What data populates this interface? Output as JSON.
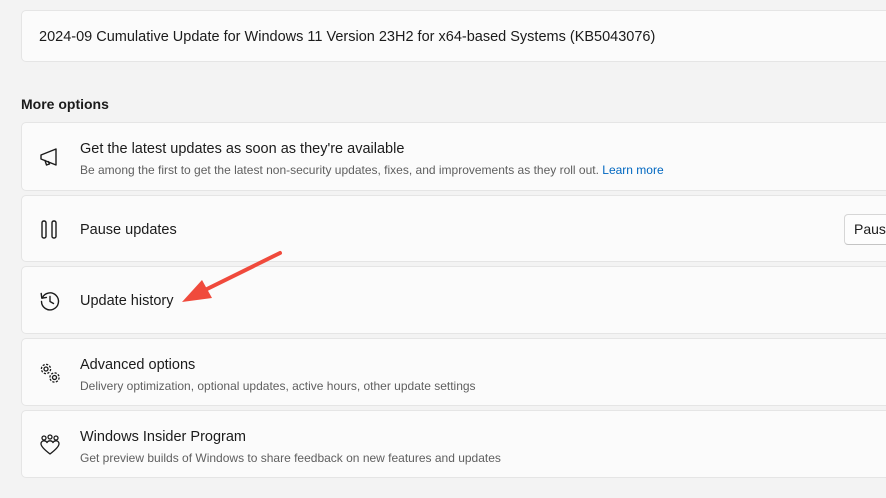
{
  "latest_update": {
    "title": "2024-09 Cumulative Update for Windows 11 Version 23H2 for x64-based Systems (KB5043076)"
  },
  "more_options": {
    "heading": "More options",
    "items": [
      {
        "label": "Get the latest updates as soon as they're available",
        "description": "Be among the first to get the latest non-security updates, fixes, and improvements as they roll out.",
        "link": "Learn more",
        "icon": "megaphone-icon"
      },
      {
        "label": "Pause updates",
        "button": "Pause",
        "icon": "pause-icon"
      },
      {
        "label": "Update history",
        "icon": "history-icon"
      },
      {
        "label": "Advanced options",
        "description": "Delivery optimization, optional updates, active hours, other update settings",
        "icon": "gears-icon"
      },
      {
        "label": "Windows Insider Program",
        "description": "Get preview builds of Windows to share feedback on new features and updates",
        "icon": "insider-icon"
      }
    ]
  },
  "annotation": {
    "arrow_color": "#f04a3c"
  },
  "colors": {
    "link": "#0067c0",
    "background": "#f3f3f3",
    "card": "#fbfbfb"
  }
}
